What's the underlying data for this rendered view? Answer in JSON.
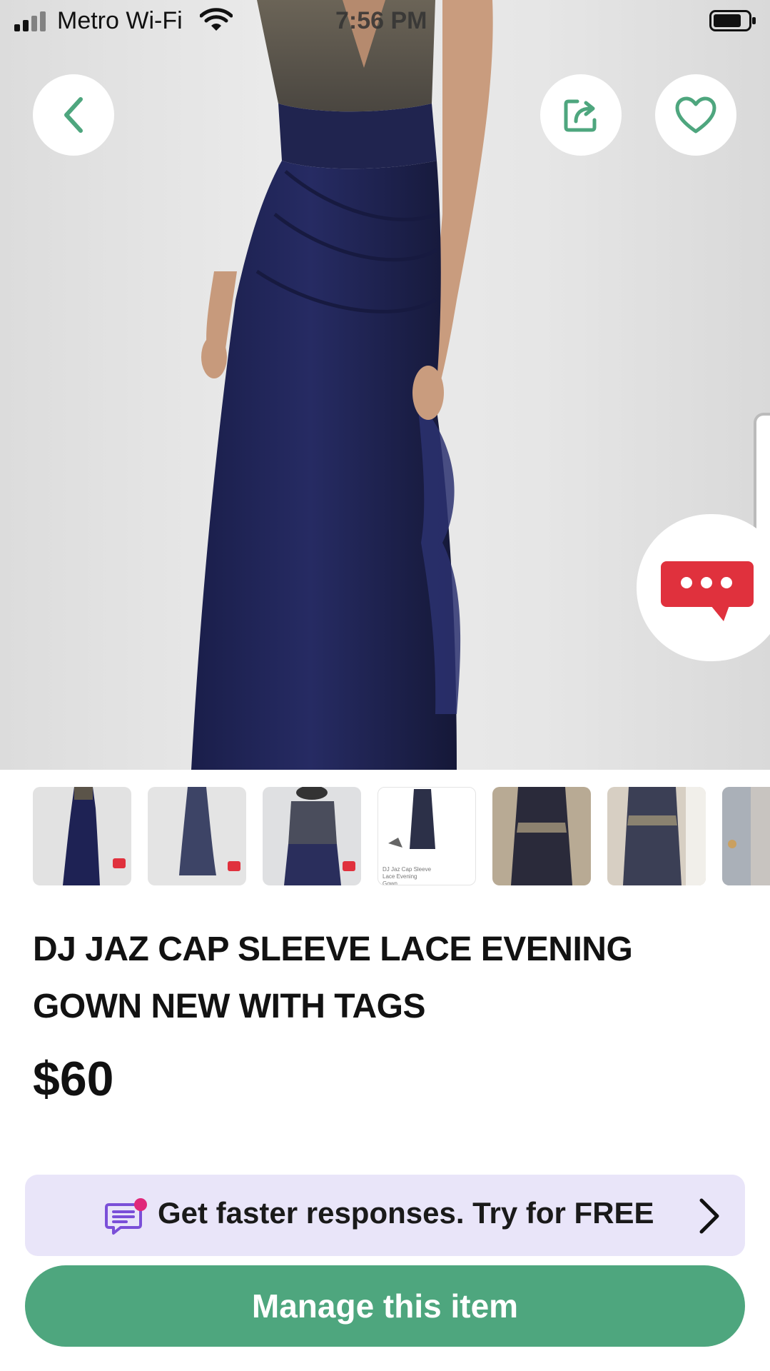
{
  "status_bar": {
    "carrier": "Metro Wi-Fi",
    "time": "7:56 PM",
    "signal_icon": "signal-icon",
    "wifi_icon": "wifi-icon",
    "battery_icon": "battery-icon"
  },
  "top_actions": {
    "back_icon": "chevron-left-icon",
    "share_icon": "share-icon",
    "favorite_icon": "heart-icon"
  },
  "listing": {
    "title": "DJ  JAZ CAP SLEEVE LACE EVENING GOWN NEW WITH TAGS",
    "price": "$60"
  },
  "thumbnails": [
    {
      "label": ""
    },
    {
      "label": ""
    },
    {
      "label": ""
    },
    {
      "label": "DJ Jaz Cap Sleeve Lace Evening Gown"
    },
    {
      "label": ""
    },
    {
      "label": ""
    },
    {
      "label": ""
    }
  ],
  "promo": {
    "text": "Get faster responses.  Try for FREE",
    "icon": "message-icon"
  },
  "manage": {
    "label": "Manage this item"
  },
  "colors": {
    "accent_green": "#4ea67e",
    "promo_bg": "#e9e5f9",
    "chat_red": "#e0313d",
    "promo_icon_purple": "#7a4fd8",
    "badge_pink": "#e0287a"
  }
}
